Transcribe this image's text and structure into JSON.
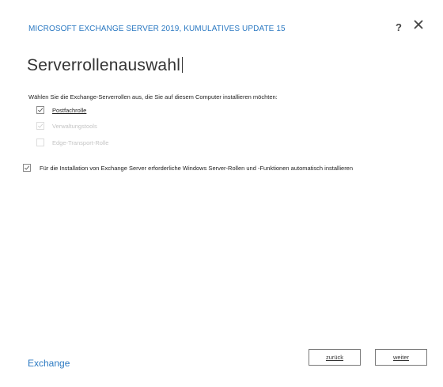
{
  "header": {
    "title": "MICROSOFT EXCHANGE SERVER 2019, KUMULATIVES UPDATE 15",
    "help_label": "?"
  },
  "page": {
    "title": "Serverrollenauswahl",
    "instruction": "Wählen Sie die Exchange-Serverrollen aus, die Sie auf diesem Computer installieren möchten:"
  },
  "roles": [
    {
      "label": "Postfachrolle",
      "checked": true,
      "enabled": true
    },
    {
      "label": "Verwaltungstools",
      "checked": true,
      "enabled": false
    },
    {
      "label": "Edge-Transport-Rolle",
      "checked": false,
      "enabled": false
    }
  ],
  "auto_install": {
    "label": "Für die Installation von Exchange Server erforderliche Windows Server-Rollen und -Funktionen automatisch installieren",
    "checked": true
  },
  "footer": {
    "logo": "Exchange",
    "back_label": "zurück",
    "next_label": "weiter"
  },
  "colors": {
    "accent": "#2b79c2"
  },
  "icons": {
    "close": "close-icon",
    "help": "help-icon",
    "check": "checkmark-icon"
  }
}
